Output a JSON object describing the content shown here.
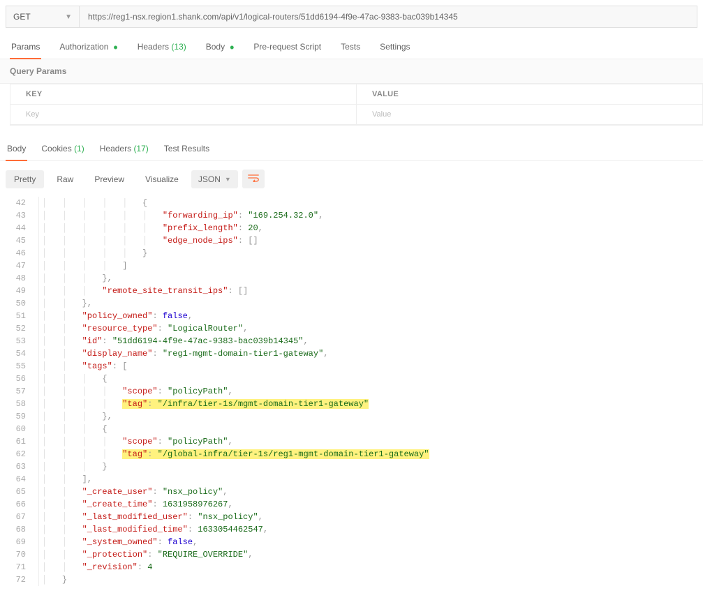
{
  "request": {
    "method": "GET",
    "url": "https://reg1-nsx.region1.shank.com/api/v1/logical-routers/51dd6194-4f9e-47ac-9383-bac039b14345"
  },
  "tabs": {
    "params": "Params",
    "authorization": "Authorization",
    "headers_label": "Headers",
    "headers_count": "(13)",
    "body": "Body",
    "prerequest": "Pre-request Script",
    "tests": "Tests",
    "settings": "Settings"
  },
  "query_params_label": "Query Params",
  "paramsTable": {
    "key_header": "KEY",
    "value_header": "VALUE",
    "key_placeholder": "Key",
    "value_placeholder": "Value"
  },
  "responseTabs": {
    "body": "Body",
    "cookies_label": "Cookies",
    "cookies_count": "(1)",
    "headers_label": "Headers",
    "headers_count": "(17)",
    "test_results": "Test Results"
  },
  "toolbar": {
    "pretty": "Pretty",
    "raw": "Raw",
    "preview": "Preview",
    "visualize": "Visualize",
    "format": "JSON"
  },
  "code": [
    {
      "n": 42,
      "i": 5,
      "tokens": [
        {
          "t": "punct",
          "v": "{"
        }
      ]
    },
    {
      "n": 43,
      "i": 6,
      "tokens": [
        {
          "t": "key",
          "v": "\"forwarding_ip\""
        },
        {
          "t": "colon",
          "v": ": "
        },
        {
          "t": "str",
          "v": "\"169.254.32.0\""
        },
        {
          "t": "punct",
          "v": ","
        }
      ]
    },
    {
      "n": 44,
      "i": 6,
      "tokens": [
        {
          "t": "key",
          "v": "\"prefix_length\""
        },
        {
          "t": "colon",
          "v": ": "
        },
        {
          "t": "num",
          "v": "20"
        },
        {
          "t": "punct",
          "v": ","
        }
      ]
    },
    {
      "n": 45,
      "i": 6,
      "tokens": [
        {
          "t": "key",
          "v": "\"edge_node_ips\""
        },
        {
          "t": "colon",
          "v": ": "
        },
        {
          "t": "punct",
          "v": "[]"
        }
      ]
    },
    {
      "n": 46,
      "i": 5,
      "tokens": [
        {
          "t": "punct",
          "v": "}"
        }
      ]
    },
    {
      "n": 47,
      "i": 4,
      "tokens": [
        {
          "t": "punct",
          "v": "]"
        }
      ]
    },
    {
      "n": 48,
      "i": 3,
      "tokens": [
        {
          "t": "punct",
          "v": "},"
        }
      ]
    },
    {
      "n": 49,
      "i": 3,
      "tokens": [
        {
          "t": "key",
          "v": "\"remote_site_transit_ips\""
        },
        {
          "t": "colon",
          "v": ": "
        },
        {
          "t": "punct",
          "v": "[]"
        }
      ]
    },
    {
      "n": 50,
      "i": 2,
      "tokens": [
        {
          "t": "punct",
          "v": "},"
        }
      ]
    },
    {
      "n": 51,
      "i": 2,
      "tokens": [
        {
          "t": "key",
          "v": "\"policy_owned\""
        },
        {
          "t": "colon",
          "v": ": "
        },
        {
          "t": "bool",
          "v": "false"
        },
        {
          "t": "punct",
          "v": ","
        }
      ]
    },
    {
      "n": 52,
      "i": 2,
      "tokens": [
        {
          "t": "key",
          "v": "\"resource_type\""
        },
        {
          "t": "colon",
          "v": ": "
        },
        {
          "t": "str",
          "v": "\"LogicalRouter\""
        },
        {
          "t": "punct",
          "v": ","
        }
      ]
    },
    {
      "n": 53,
      "i": 2,
      "tokens": [
        {
          "t": "key",
          "v": "\"id\""
        },
        {
          "t": "colon",
          "v": ": "
        },
        {
          "t": "str",
          "v": "\"51dd6194-4f9e-47ac-9383-bac039b14345\""
        },
        {
          "t": "punct",
          "v": ","
        }
      ]
    },
    {
      "n": 54,
      "i": 2,
      "tokens": [
        {
          "t": "key",
          "v": "\"display_name\""
        },
        {
          "t": "colon",
          "v": ": "
        },
        {
          "t": "str",
          "v": "\"reg1-mgmt-domain-tier1-gateway\""
        },
        {
          "t": "punct",
          "v": ","
        }
      ]
    },
    {
      "n": 55,
      "i": 2,
      "tokens": [
        {
          "t": "key",
          "v": "\"tags\""
        },
        {
          "t": "colon",
          "v": ": "
        },
        {
          "t": "punct",
          "v": "["
        }
      ]
    },
    {
      "n": 56,
      "i": 3,
      "tokens": [
        {
          "t": "punct",
          "v": "{"
        }
      ]
    },
    {
      "n": 57,
      "i": 4,
      "tokens": [
        {
          "t": "key",
          "v": "\"scope\""
        },
        {
          "t": "colon",
          "v": ": "
        },
        {
          "t": "str",
          "v": "\"policyPath\""
        },
        {
          "t": "punct",
          "v": ","
        }
      ]
    },
    {
      "n": 58,
      "i": 4,
      "tokens": [
        {
          "t": "key",
          "v": "\"tag\"",
          "hl": true
        },
        {
          "t": "colon",
          "v": ": ",
          "hl": true
        },
        {
          "t": "str",
          "v": "\"/infra/tier-1s/mgmt-domain-tier1-gateway\"",
          "hl": true
        }
      ]
    },
    {
      "n": 59,
      "i": 3,
      "tokens": [
        {
          "t": "punct",
          "v": "},"
        }
      ]
    },
    {
      "n": 60,
      "i": 3,
      "tokens": [
        {
          "t": "punct",
          "v": "{"
        }
      ]
    },
    {
      "n": 61,
      "i": 4,
      "tokens": [
        {
          "t": "key",
          "v": "\"scope\""
        },
        {
          "t": "colon",
          "v": ": "
        },
        {
          "t": "str",
          "v": "\"policyPath\""
        },
        {
          "t": "punct",
          "v": ","
        }
      ]
    },
    {
      "n": 62,
      "i": 4,
      "tokens": [
        {
          "t": "key",
          "v": "\"tag\"",
          "hl": true
        },
        {
          "t": "colon",
          "v": ": ",
          "hl": true
        },
        {
          "t": "str",
          "v": "\"/global-infra/tier-1s/reg1-mgmt-domain-tier1-gateway\"",
          "hl": true
        }
      ]
    },
    {
      "n": 63,
      "i": 3,
      "tokens": [
        {
          "t": "punct",
          "v": "}"
        }
      ]
    },
    {
      "n": 64,
      "i": 2,
      "tokens": [
        {
          "t": "punct",
          "v": "],"
        }
      ]
    },
    {
      "n": 65,
      "i": 2,
      "tokens": [
        {
          "t": "key",
          "v": "\"_create_user\""
        },
        {
          "t": "colon",
          "v": ": "
        },
        {
          "t": "str",
          "v": "\"nsx_policy\""
        },
        {
          "t": "punct",
          "v": ","
        }
      ]
    },
    {
      "n": 66,
      "i": 2,
      "tokens": [
        {
          "t": "key",
          "v": "\"_create_time\""
        },
        {
          "t": "colon",
          "v": ": "
        },
        {
          "t": "num",
          "v": "1631958976267"
        },
        {
          "t": "punct",
          "v": ","
        }
      ]
    },
    {
      "n": 67,
      "i": 2,
      "tokens": [
        {
          "t": "key",
          "v": "\"_last_modified_user\""
        },
        {
          "t": "colon",
          "v": ": "
        },
        {
          "t": "str",
          "v": "\"nsx_policy\""
        },
        {
          "t": "punct",
          "v": ","
        }
      ]
    },
    {
      "n": 68,
      "i": 2,
      "tokens": [
        {
          "t": "key",
          "v": "\"_last_modified_time\""
        },
        {
          "t": "colon",
          "v": ": "
        },
        {
          "t": "num",
          "v": "1633054462547"
        },
        {
          "t": "punct",
          "v": ","
        }
      ]
    },
    {
      "n": 69,
      "i": 2,
      "tokens": [
        {
          "t": "key",
          "v": "\"_system_owned\""
        },
        {
          "t": "colon",
          "v": ": "
        },
        {
          "t": "bool",
          "v": "false"
        },
        {
          "t": "punct",
          "v": ","
        }
      ]
    },
    {
      "n": 70,
      "i": 2,
      "tokens": [
        {
          "t": "key",
          "v": "\"_protection\""
        },
        {
          "t": "colon",
          "v": ": "
        },
        {
          "t": "str",
          "v": "\"REQUIRE_OVERRIDE\""
        },
        {
          "t": "punct",
          "v": ","
        }
      ]
    },
    {
      "n": 71,
      "i": 2,
      "tokens": [
        {
          "t": "key",
          "v": "\"_revision\""
        },
        {
          "t": "colon",
          "v": ": "
        },
        {
          "t": "num",
          "v": "4"
        }
      ]
    },
    {
      "n": 72,
      "i": 1,
      "tokens": [
        {
          "t": "punct",
          "v": "}"
        }
      ]
    }
  ]
}
